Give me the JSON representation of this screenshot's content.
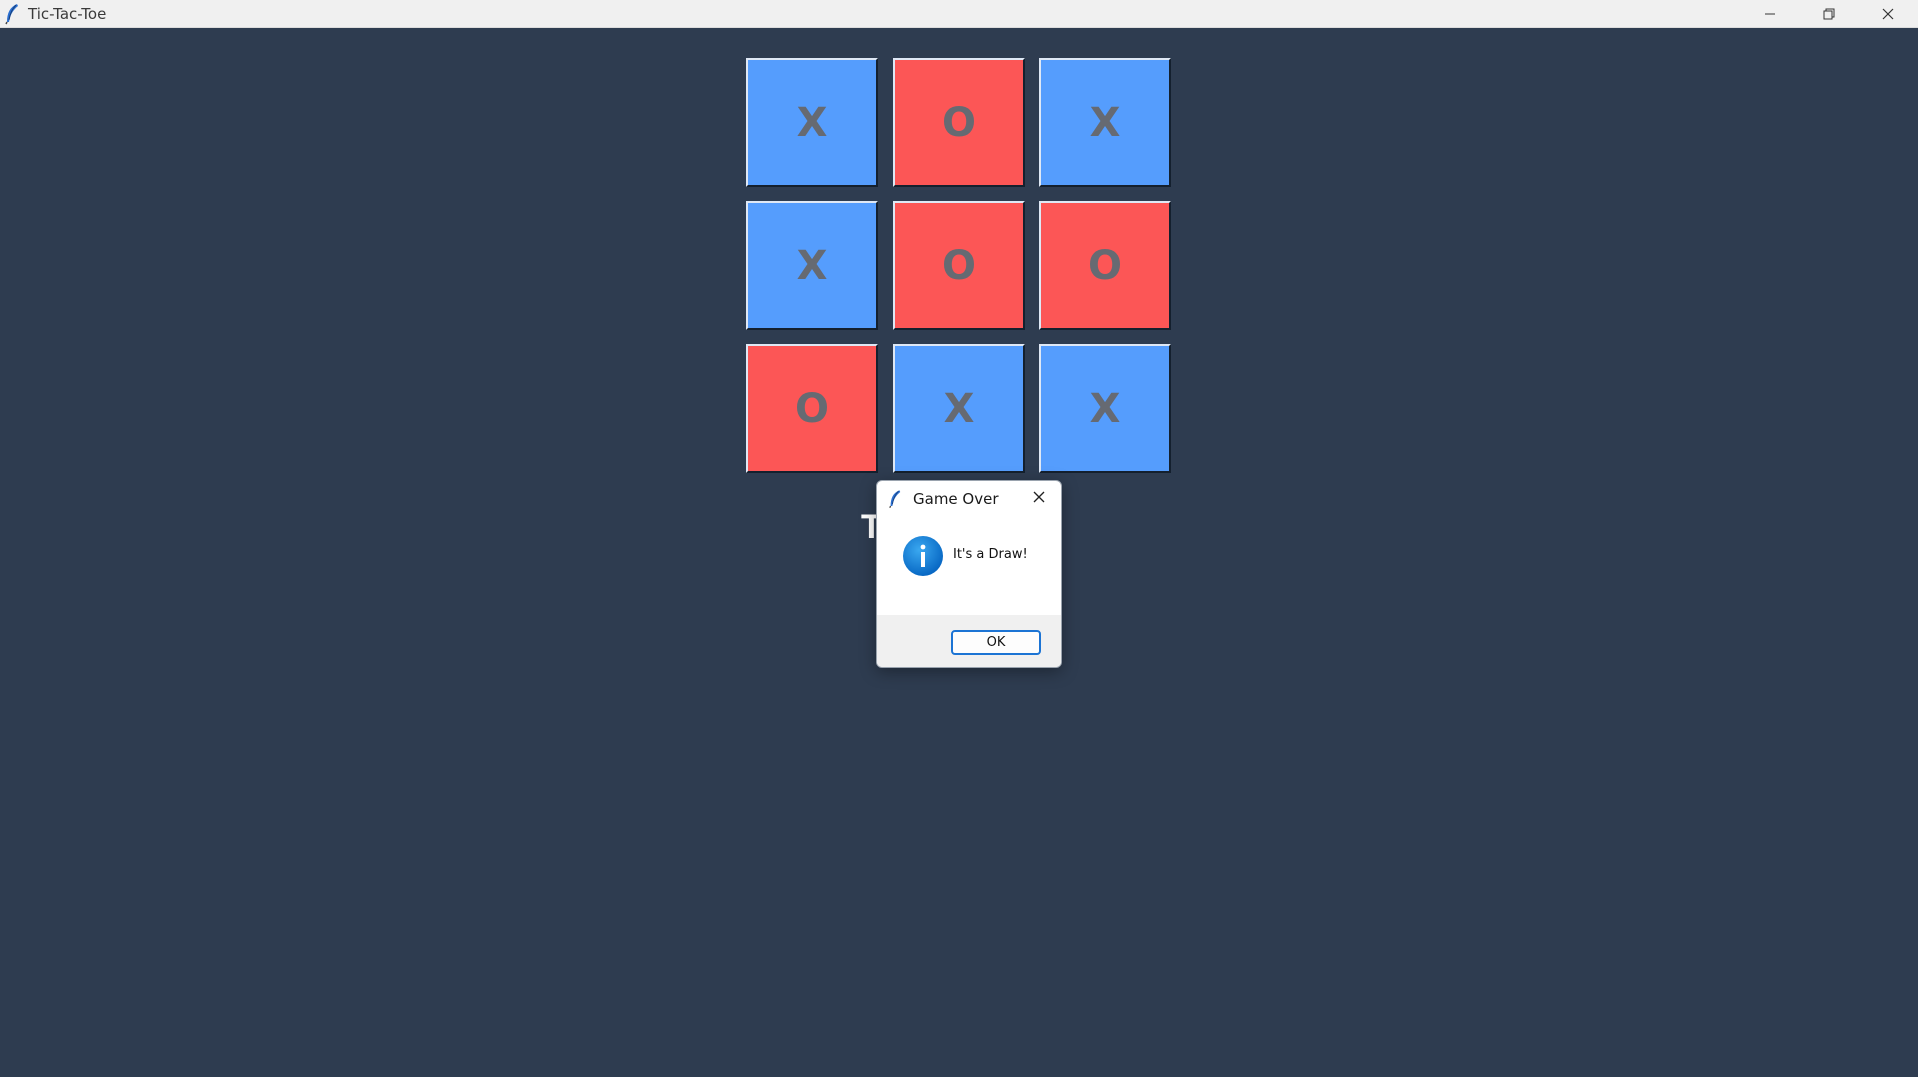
{
  "window": {
    "title": "Tic-Tac-Toe",
    "app_icon": "feather-icon",
    "controls": [
      "minimize-icon",
      "restore-icon",
      "close-icon"
    ]
  },
  "board": {
    "cells": [
      {
        "mark": "X",
        "color": "#559dfd"
      },
      {
        "mark": "O",
        "color": "#fc5656"
      },
      {
        "mark": "X",
        "color": "#559dfd"
      },
      {
        "mark": "X",
        "color": "#559dfd"
      },
      {
        "mark": "O",
        "color": "#fc5656"
      },
      {
        "mark": "O",
        "color": "#fc5656"
      },
      {
        "mark": "O",
        "color": "#fc5656"
      },
      {
        "mark": "X",
        "color": "#559dfd"
      },
      {
        "mark": "X",
        "color": "#559dfd"
      }
    ]
  },
  "status": {
    "text_visible": "T"
  },
  "dialog": {
    "title": "Game Over",
    "icon": "info-icon",
    "message": "It's a Draw!",
    "ok_label": "OK"
  },
  "colors": {
    "background": "#2e3c50",
    "x_cell": "#559dfd",
    "o_cell": "#fc5656",
    "mark_text": "#666a72",
    "ok_border": "#1c74d4"
  }
}
